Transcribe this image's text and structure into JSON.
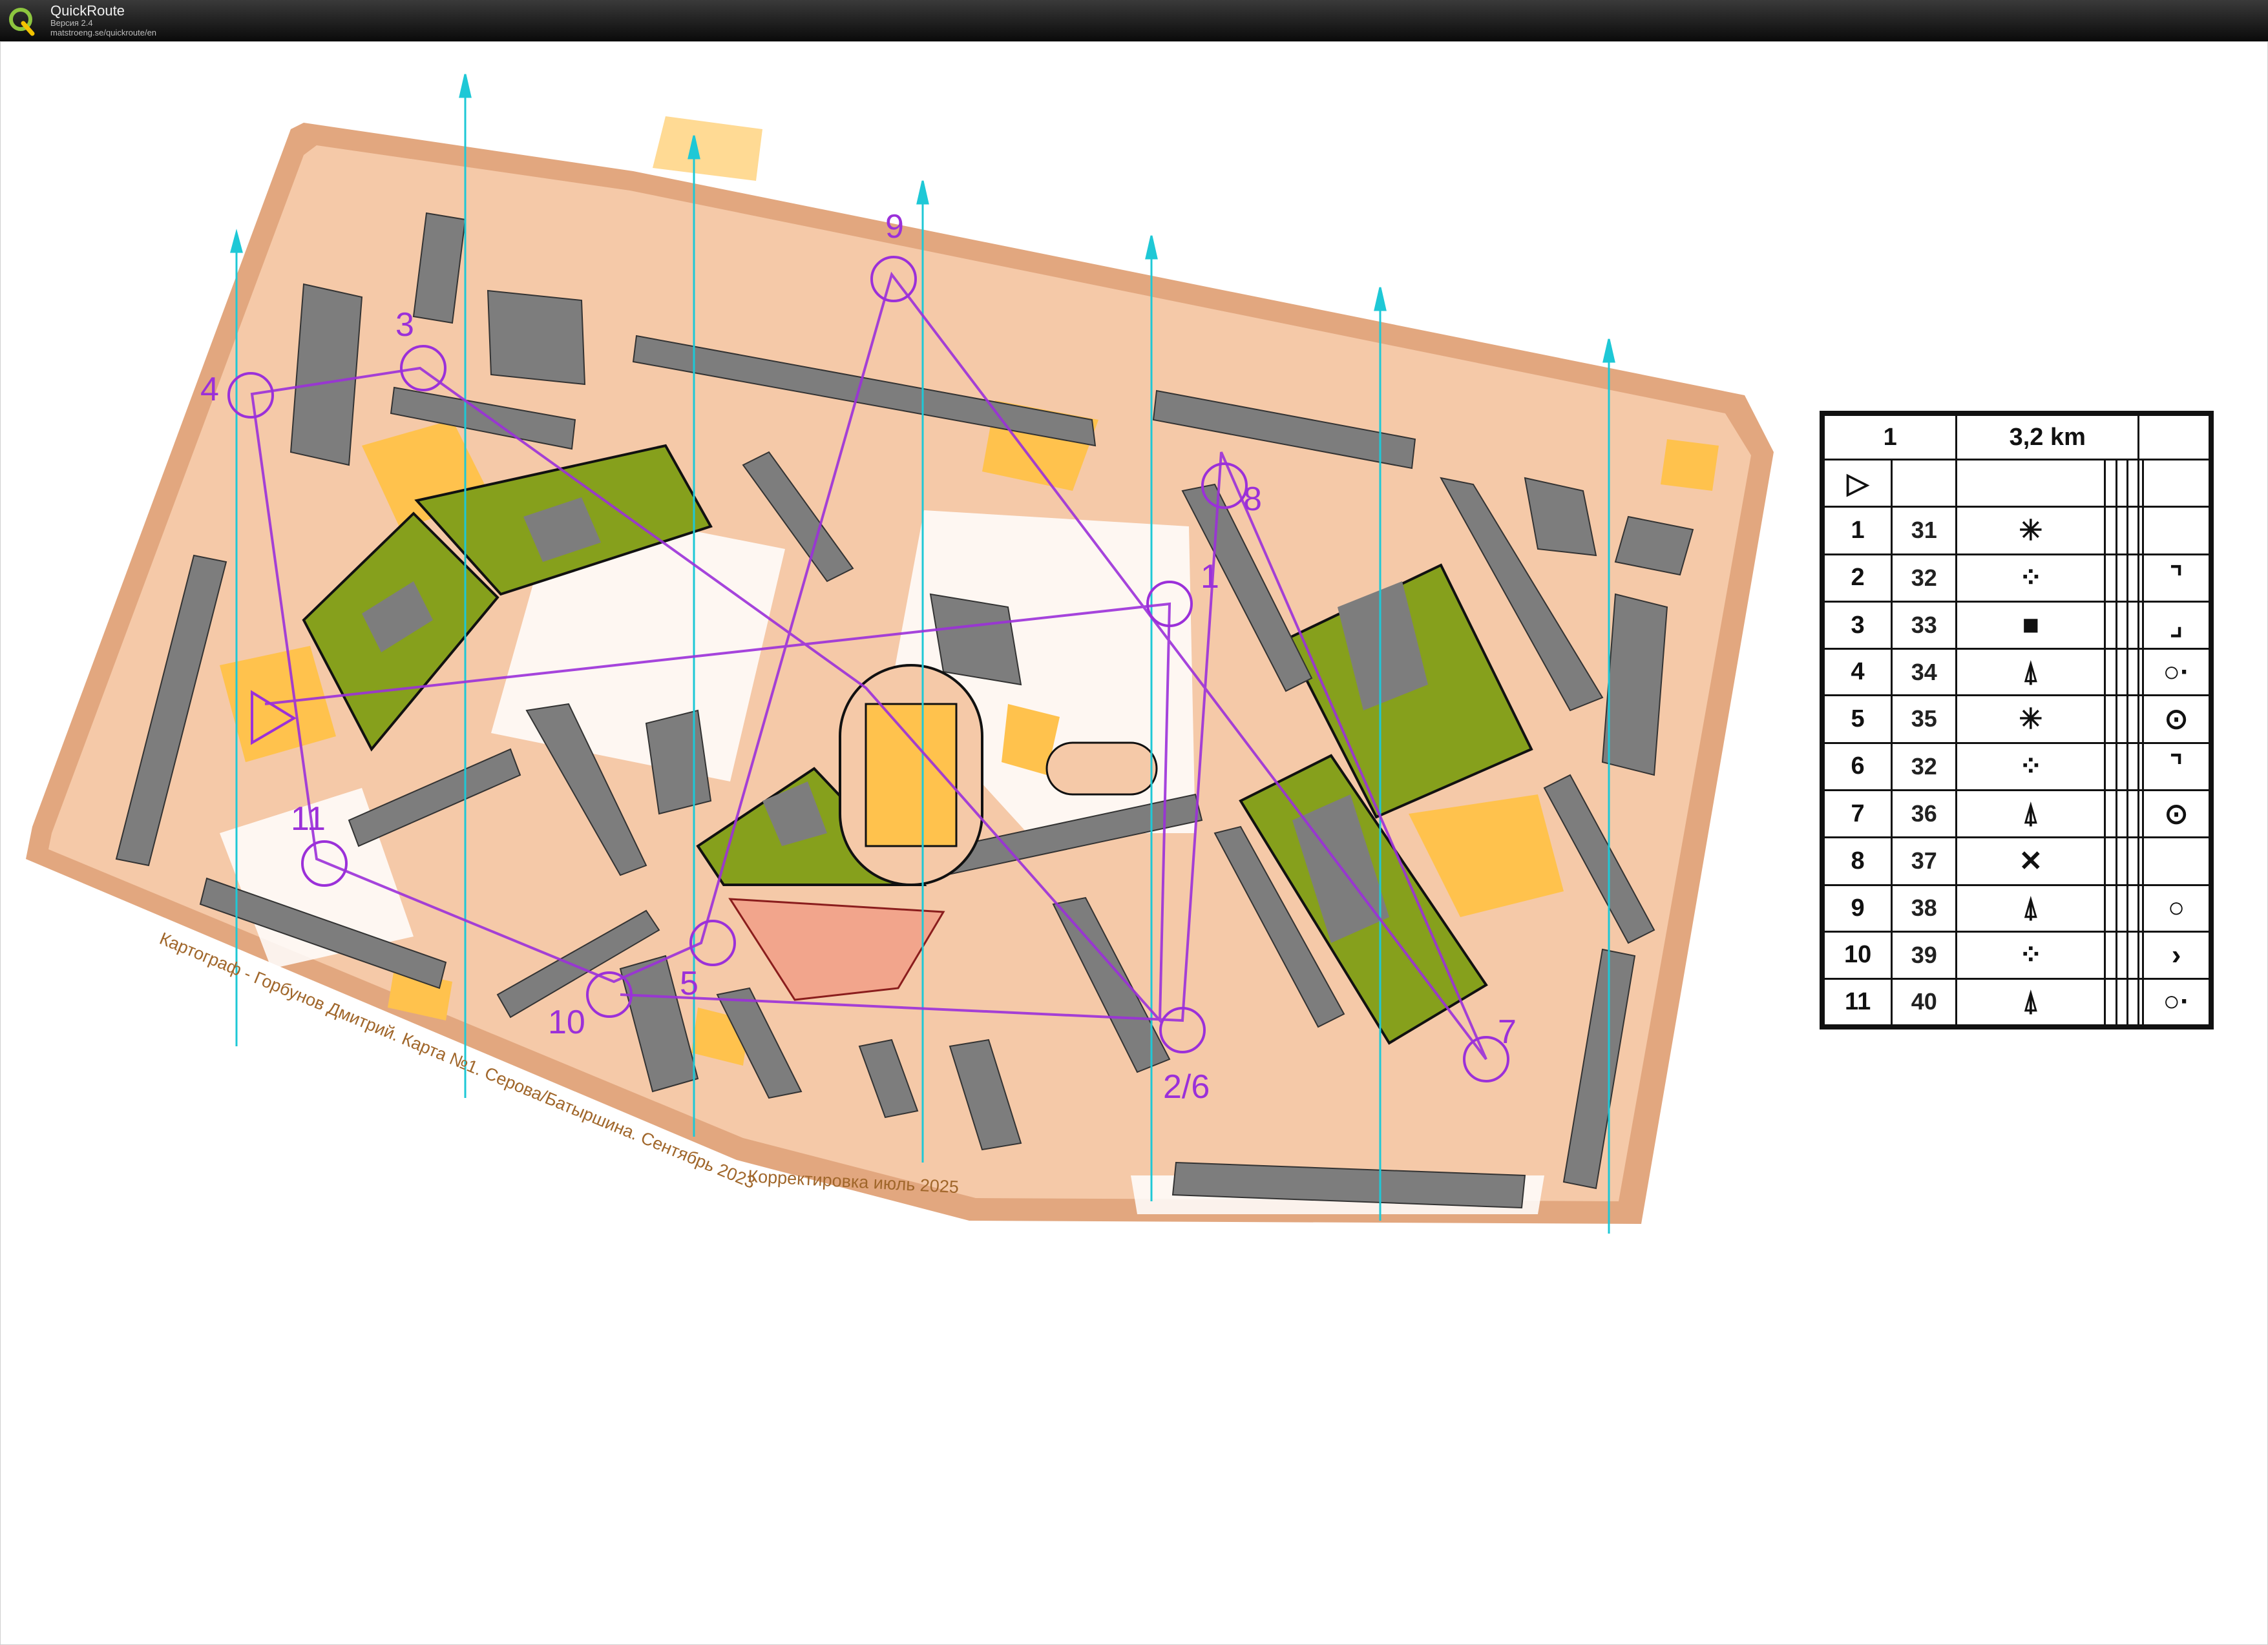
{
  "app": {
    "name": "QuickRoute",
    "version": "Версия 2.4",
    "url": "matstroeng.se/quickroute/en"
  },
  "map": {
    "controls": [
      {
        "label": "1"
      },
      {
        "label": "2/6"
      },
      {
        "label": "3"
      },
      {
        "label": "4"
      },
      {
        "label": "5"
      },
      {
        "label": "7"
      },
      {
        "label": "8"
      },
      {
        "label": "9"
      },
      {
        "label": "10"
      },
      {
        "label": "11"
      }
    ],
    "credit_line": "Картограф - Горбунов Дмитрий. Карта №1. Серова/Батыршина. Сентябрь 2023",
    "correction_line": "Корректировка июль 2025",
    "colors": {
      "background": "#ffffff",
      "paved": "#f5c9a8",
      "border": "#e2a77f",
      "open": "#ffc24d",
      "forest": "#86a01c",
      "building": "#7d7d7d",
      "course": "#9b30d9",
      "north_lines": "#1ec8d6"
    }
  },
  "description_sheet": {
    "course": "1",
    "length": "3,2 km",
    "start_symbol": "▷",
    "rows": [
      {
        "num": "1",
        "code": "31",
        "feature": "✳",
        "detail": ""
      },
      {
        "num": "2",
        "code": "32",
        "feature": "⁘",
        "detail": "⌝"
      },
      {
        "num": "3",
        "code": "33",
        "feature": "■",
        "detail": "⌟"
      },
      {
        "num": "4",
        "code": "34",
        "feature": "⍋",
        "detail": "○·"
      },
      {
        "num": "5",
        "code": "35",
        "feature": "✳",
        "detail": "⊙"
      },
      {
        "num": "6",
        "code": "32",
        "feature": "⁘",
        "detail": "⌝"
      },
      {
        "num": "7",
        "code": "36",
        "feature": "⍋",
        "detail": "⊙"
      },
      {
        "num": "8",
        "code": "37",
        "feature": "✕",
        "detail": ""
      },
      {
        "num": "9",
        "code": "38",
        "feature": "⍋",
        "detail": "○"
      },
      {
        "num": "10",
        "code": "39",
        "feature": "⁘",
        "detail": "›"
      },
      {
        "num": "11",
        "code": "40",
        "feature": "⍋",
        "detail": "○·"
      }
    ]
  }
}
